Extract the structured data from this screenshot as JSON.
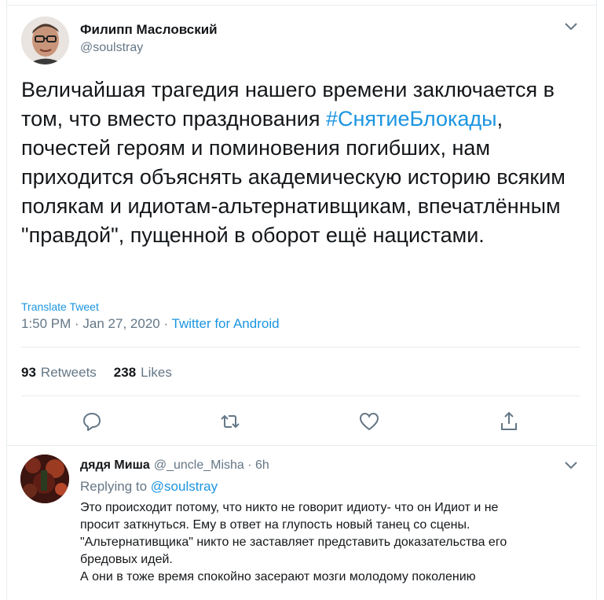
{
  "tweet": {
    "author_name": "Филипп Масловский",
    "author_handle": "@soulstray",
    "text_before": "Величайшая трагедия нашего времени заключается в том, что вместо празднования ",
    "hashtag": "#СнятиеБлокады",
    "text_after": ", почестей героям и поминовения погибших, нам приходится объяснять академическую историю всяким полякам и идиотам-альтернативщикам, впечатлённым \"правдой\", пущенной в оборот ещё нацистами.",
    "translate_label": "Translate Tweet",
    "time": "1:50 PM",
    "sep1": " · ",
    "date": "Jan 27, 2020",
    "sep2": " · ",
    "source": "Twitter for Android",
    "retweets_count": "93",
    "retweets_label": "Retweets",
    "likes_count": "238",
    "likes_label": "Likes"
  },
  "actions": [
    {
      "icon": "reply-icon"
    },
    {
      "icon": "retweet-icon"
    },
    {
      "icon": "like-icon"
    },
    {
      "icon": "share-icon"
    }
  ],
  "reply": {
    "author_name": "дядя Миша",
    "author_handle": "@_uncle_Misha · 6h",
    "replying_prefix": "Replying to ",
    "replying_to": "@soulstray",
    "lines": [
      "Это происходит потому, что никто не говорит идиоту- что он Идиот и не",
      "просит заткнуться. Ему в ответ на глупость новый танец со сцены.",
      "\"Альтернативщика\" никто не заставляет представить доказательства его",
      "бредовых идей.",
      "А они в тоже время спокойно засерают мозги молодому поколению"
    ]
  },
  "colors": {
    "link": "#1b95e0",
    "secondary": "#657786",
    "primary": "#14171a",
    "border": "#e6ecf0"
  }
}
